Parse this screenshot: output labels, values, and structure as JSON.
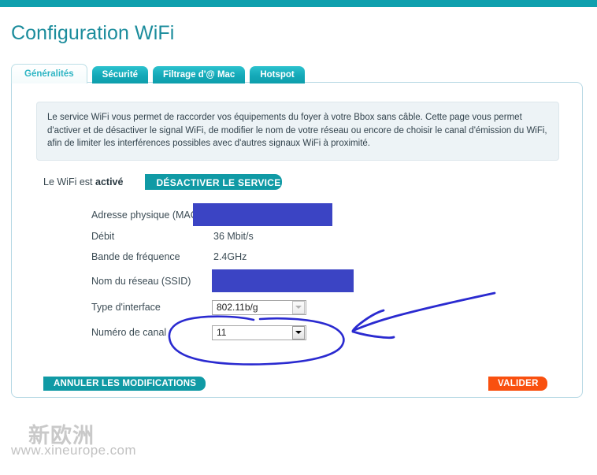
{
  "theme": {
    "teal": "#0fa0ae",
    "teal_dark": "#109aa5",
    "title_color": "#1b8c9c",
    "orange": "#f9500f",
    "redaction_color": "#3b44c4",
    "annotation_color": "#2a2ad0",
    "panel_border": "#b6d8e4",
    "info_bg": "#edf3f6"
  },
  "header": {
    "title": "Configuration WiFi"
  },
  "tabs": [
    {
      "label": "Généralités",
      "active": true
    },
    {
      "label": "Sécurité",
      "active": false
    },
    {
      "label": "Filtrage d'@ Mac",
      "active": false
    },
    {
      "label": "Hotspot",
      "active": false
    }
  ],
  "info": {
    "text": "Le service WiFi vous permet de raccorder vos équipements du foyer à votre Bbox sans câble. Cette page vous permet d'activer et de désactiver le signal WiFi, de modifier le nom de votre réseau ou encore de choisir le canal d'émission du WiFi, afin de limiter les interférences possibles avec d'autres signaux WiFi à proximité."
  },
  "status": {
    "prefix": "Le WiFi est ",
    "state": "activé",
    "toggle_label": "DÉSACTIVER LE SERVICE"
  },
  "form": {
    "mac": {
      "label": "Adresse physique (MAC)",
      "value": "",
      "redacted": true
    },
    "debit": {
      "label": "Débit",
      "value": "36 Mbit/s",
      "redacted": false
    },
    "band": {
      "label": "Bande de fréquence",
      "value": "2.4GHz",
      "redacted": false
    },
    "ssid": {
      "label": "Nom du réseau (SSID)",
      "value": "",
      "redacted": true
    },
    "interface_type": {
      "label": "Type d'interface",
      "value": "802.11b/g",
      "disabled": true
    },
    "channel": {
      "label": "Numéro de canal",
      "value": "11",
      "disabled": false
    }
  },
  "footer": {
    "cancel_label": "ANNULER LES MODIFICATIONS",
    "validate_label": "VALIDER"
  },
  "annotation": {
    "description": "hand-drawn-blue-ellipse-and-arrow-highlighting-channel-dropdown"
  },
  "watermark": {
    "cn": "新欧洲",
    "url": "www.xineurope.com"
  }
}
